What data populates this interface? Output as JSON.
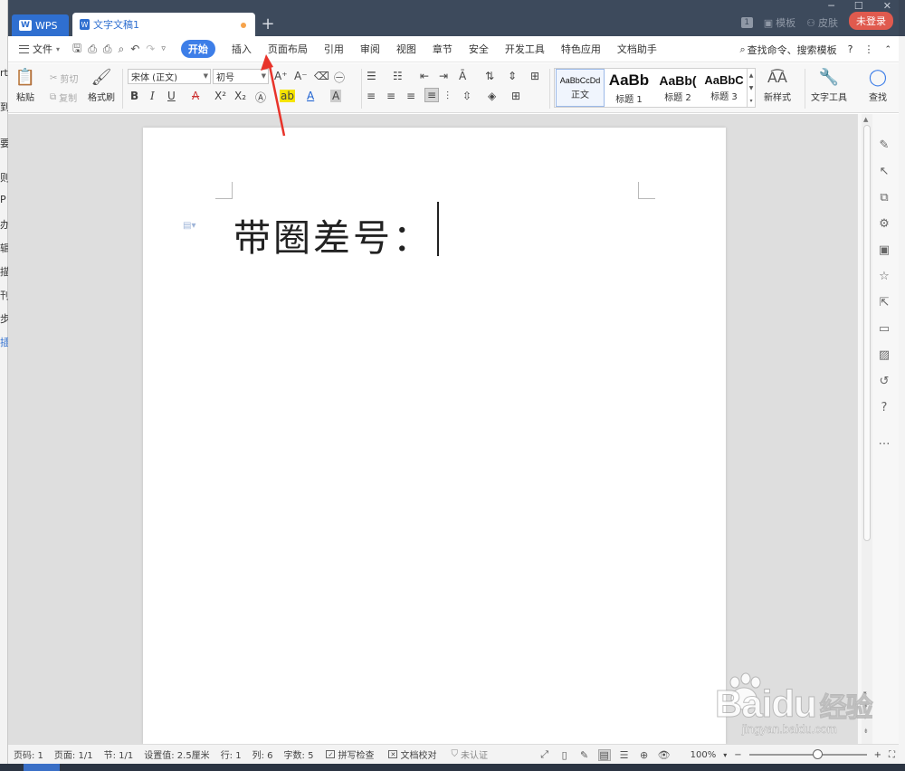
{
  "behind_window": {
    "fragments": [
      "rt",
      "到",
      "要",
      "则",
      "P",
      "办",
      "辑",
      "描",
      "刊",
      "步",
      "插"
    ]
  },
  "title_bar": {
    "wps_tab": "WPS",
    "doc_tab": "文字文稿1",
    "new_tab": "+",
    "badge": "1",
    "template": "模板",
    "skin": "皮肤",
    "login": "未登录",
    "win_min": "─",
    "win_max": "☐",
    "win_close": "✕"
  },
  "menu_bar": {
    "file": "文件",
    "items": [
      "开始",
      "插入",
      "页面布局",
      "引用",
      "审阅",
      "视图",
      "章节",
      "安全",
      "开发工具",
      "特色应用",
      "文档助手"
    ],
    "active_item": "开始",
    "search": "查找命令、搜索模板",
    "help": "?",
    "more": "⋮"
  },
  "ribbon": {
    "paste": "粘贴",
    "cut": "剪切",
    "copy": "复制",
    "format_painter": "格式刷",
    "font_name": "宋体 (正文)",
    "font_size": "初号",
    "styles": [
      {
        "sample": "AaBbCcDd",
        "label": "正文"
      },
      {
        "sample": "AaBb",
        "label": "标题 1"
      },
      {
        "sample": "AaBb(",
        "label": "标题 2"
      },
      {
        "sample": "AaBbC",
        "label": "标题 3"
      }
    ],
    "new_style": "新样式",
    "text_tools": "文字工具",
    "find": "查找"
  },
  "document": {
    "text": "带圈差号："
  },
  "status_bar": {
    "page_num": "页码: 1",
    "pages": "页面: 1/1",
    "section": "节: 1/1",
    "position": "设置值: 2.5厘米",
    "line": "行: 1",
    "column": "列: 6",
    "word_count": "字数: 5",
    "spell_check": "拼写检查",
    "doc_proof": "文档校对",
    "certify": "未认证",
    "zoom": "100%",
    "zoom_minus": "−",
    "zoom_plus": "+"
  },
  "watermark": {
    "brand": "Bai",
    "brand_end": "du",
    "cn": "经验",
    "url": "jingyan.baidu.com"
  },
  "colors": {
    "accent": "#3d7ee8",
    "titlebar": "#3d4a5c",
    "login": "#e05a4e",
    "arrow": "#e8332a"
  }
}
